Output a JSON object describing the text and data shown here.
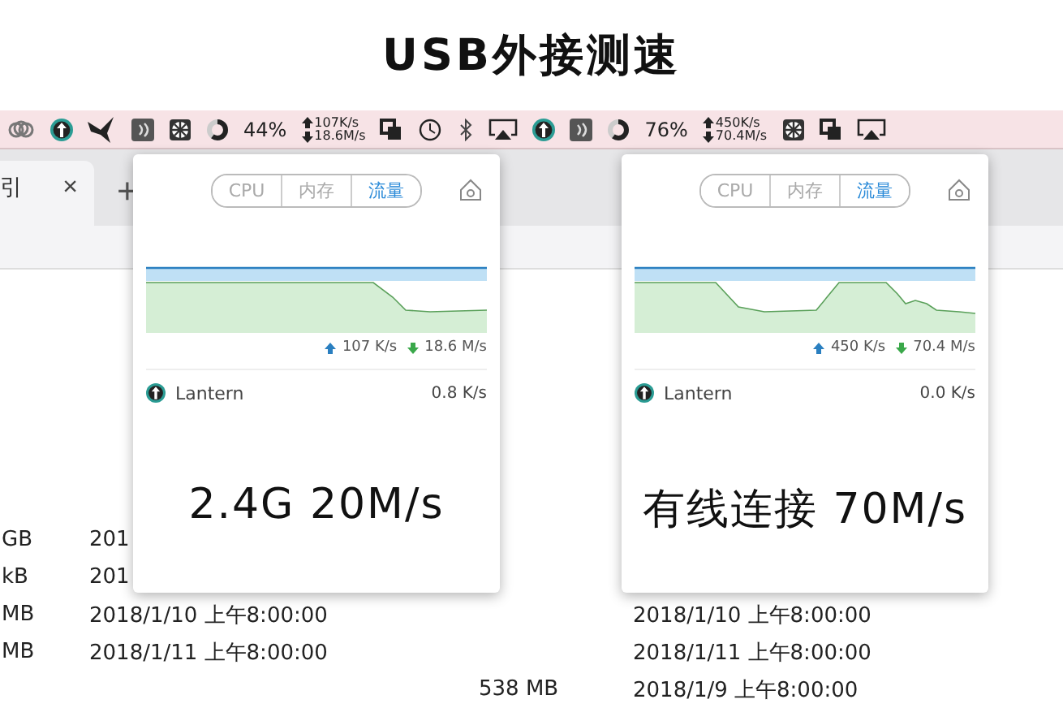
{
  "title": "USB外接测速",
  "menubar": {
    "meters": [
      {
        "percent": "44%",
        "up": "107K/s",
        "down": "18.6M/s"
      },
      {
        "percent": "76%",
        "up": "450K/s",
        "down": "70.4M/s"
      }
    ]
  },
  "browser": {
    "tab": {
      "label": "引",
      "close": "×"
    },
    "new_tab": "+"
  },
  "file_rows": [
    {
      "size": "GB",
      "date": "201"
    },
    {
      "size": "kB",
      "date": "201"
    },
    {
      "size": "MB",
      "date": "2018/1/10 上午8:00:00",
      "date_2": "2018/1/10 上午8:00:00"
    },
    {
      "size": "MB",
      "date": "2018/1/11 上午8:00:00",
      "date_2": "2018/1/11 上午8:00:00"
    },
    {
      "size_2": "538 MB",
      "date_2": "2018/1/9 上午8:00:00"
    }
  ],
  "popovers": [
    {
      "tabs": [
        {
          "label": "CPU",
          "selected": false
        },
        {
          "label": "内存",
          "selected": false
        },
        {
          "label": "流量",
          "selected": true
        }
      ],
      "upload": "107 K/s",
      "download": "18.6 M/s",
      "app": {
        "name": "Lantern",
        "rate": "0.8 K/s"
      },
      "caption": "2.4G 20M/s"
    },
    {
      "tabs": [
        {
          "label": "CPU",
          "selected": false
        },
        {
          "label": "内存",
          "selected": false
        },
        {
          "label": "流量",
          "selected": true
        }
      ],
      "upload": "450 K/s",
      "download": "70.4 M/s",
      "app": {
        "name": "Lantern",
        "rate": "0.0 K/s"
      },
      "caption": "有线连接 70M/s"
    }
  ]
}
